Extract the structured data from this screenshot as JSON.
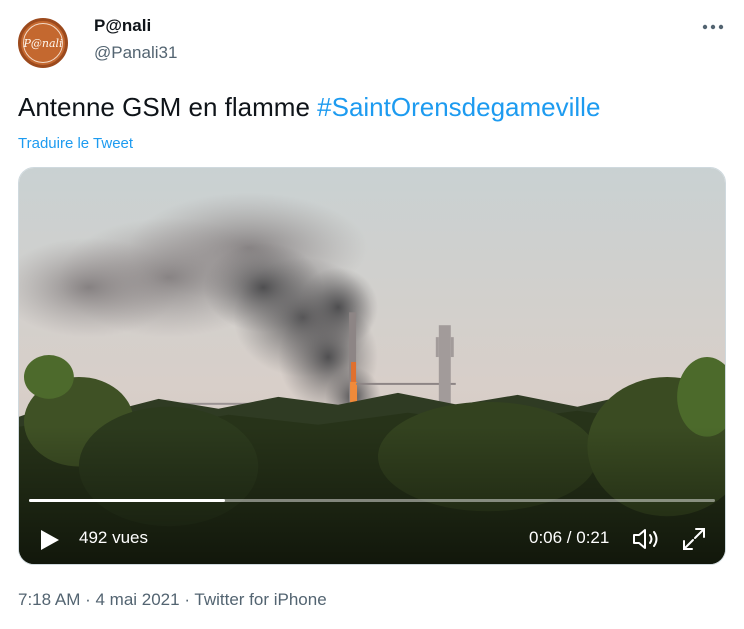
{
  "author": {
    "display_name": "P@nali",
    "handle": "@Panali31",
    "avatar_text": "P@nali"
  },
  "more_icon": "more-horizontal-icon",
  "tweet": {
    "text": "Antenne GSM en flamme ",
    "hashtag": "#SaintOrensdegameville",
    "translate_label": "Traduire le Tweet"
  },
  "video": {
    "views": "492 vues",
    "time": "0:06 / 0:21",
    "progress": 0.286,
    "icons": [
      "play-icon",
      "volume-icon",
      "fullscreen-icon"
    ]
  },
  "meta": {
    "text": "7:18 AM · 4 mai 2021 · Twitter for iPhone"
  },
  "colors": {
    "accent": "#1d9bf0",
    "secondary_text": "#536471"
  }
}
